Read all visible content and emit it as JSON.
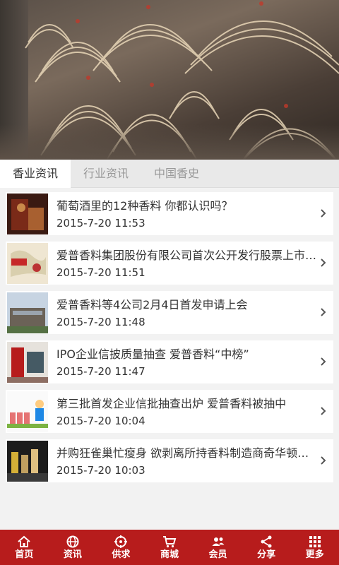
{
  "tabs": [
    {
      "label": "香业资讯"
    },
    {
      "label": "行业资讯"
    },
    {
      "label": "中国香史"
    }
  ],
  "news": [
    {
      "title": "葡萄酒里的12种香料 你都认识吗？",
      "date": "2015-7-20 11:53"
    },
    {
      "title": "爱普香料集团股份有限公司首次公开发行股票上市…",
      "date": "2015-7-20 11:51"
    },
    {
      "title": "爱普香料等4公司2月4日首发申请上会",
      "date": "2015-7-20 11:48"
    },
    {
      "title": "IPO企业信披质量抽查 爱普香料“中榜”",
      "date": "2015-7-20 11:47"
    },
    {
      "title": "第三批首发企业信批抽查出炉 爱普香料被抽中",
      "date": "2015-7-20 10:04"
    },
    {
      "title": "并购狂雀巢忙瘦身 欲剥离所持香料制造商奇华顿股份",
      "date": "2015-7-20 10:03"
    }
  ],
  "nav": [
    {
      "label": "首页",
      "icon": "home-icon"
    },
    {
      "label": "资讯",
      "icon": "globe-icon"
    },
    {
      "label": "供求",
      "icon": "target-icon"
    },
    {
      "label": "商城",
      "icon": "cart-icon"
    },
    {
      "label": "会员",
      "icon": "users-icon"
    },
    {
      "label": "分享",
      "icon": "share-icon"
    },
    {
      "label": "更多",
      "icon": "grid-icon"
    }
  ],
  "colors": {
    "nav_bg": "#b71c1c",
    "active_tab_bg": "#ffffff"
  }
}
